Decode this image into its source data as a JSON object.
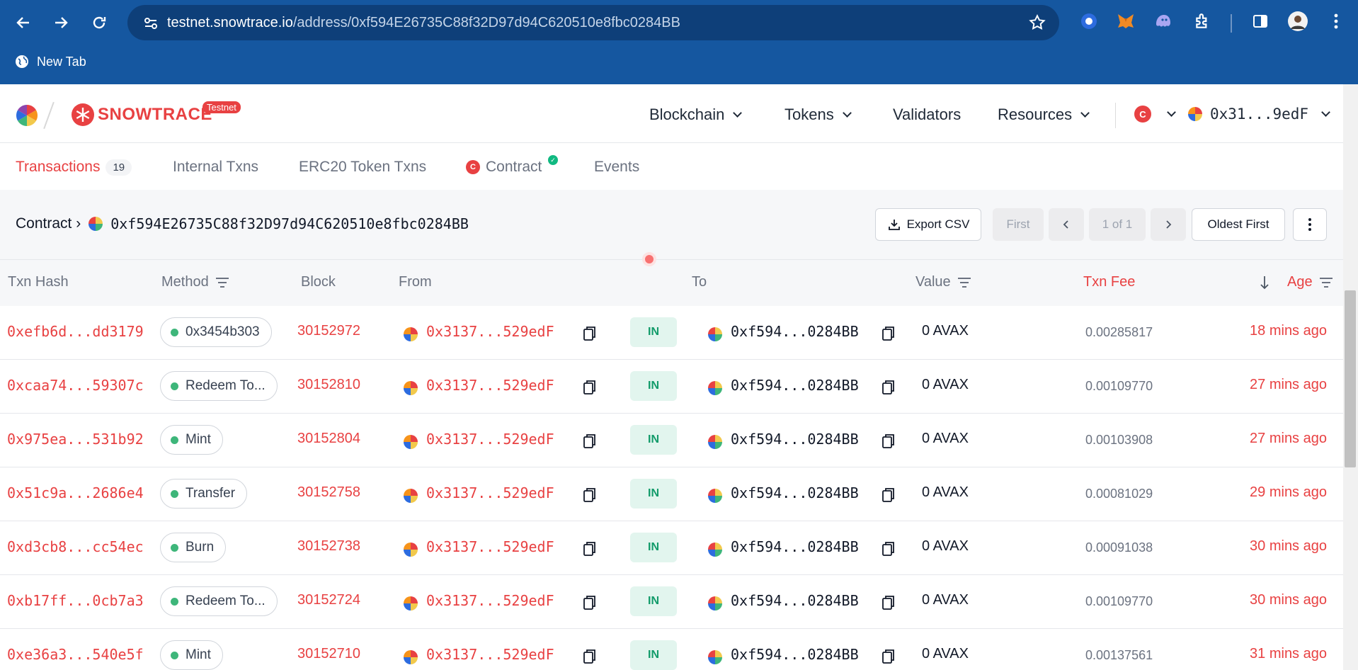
{
  "browser": {
    "url_host": "testnet.snowtrace.io",
    "url_path": "/address/0xf594E26735C88f32D97d94C620510e8fbc0284BB",
    "bookmark_label": "New Tab"
  },
  "header": {
    "logo_text": "SNOWTRACE",
    "badge": "Testnet",
    "nav": [
      "Blockchain",
      "Tokens",
      "Validators",
      "Resources"
    ],
    "chain_letter": "C",
    "wallet": "0x31...9edF"
  },
  "tabs": {
    "transactions": "Transactions",
    "transactions_count": "19",
    "internal": "Internal Txns",
    "erc20": "ERC20 Token Txns",
    "contract": "Contract",
    "contract_icon_letter": "C",
    "events": "Events"
  },
  "subheader": {
    "contract_label": "Contract ›",
    "contract_address": "0xf594E26735C88f32D97d94C620510e8fbc0284BB",
    "export_label": "Export CSV",
    "first_label": "First",
    "page_label": "1 of 1",
    "sort_label": "Oldest First"
  },
  "columns": {
    "hash": "Txn Hash",
    "method": "Method",
    "block": "Block",
    "from": "From",
    "to": "To",
    "value": "Value",
    "fee": "Txn Fee",
    "age": "Age"
  },
  "rows": [
    {
      "hash": "0xefb6d...dd3179",
      "method": "0x3454b303",
      "block": "30152972",
      "from": "0x3137...529edF",
      "direction": "IN",
      "to": "0xf594...0284BB",
      "value": "0 AVAX",
      "fee": "0.00285817",
      "age": "18 mins ago"
    },
    {
      "hash": "0xcaa74...59307c",
      "method": "Redeem To...",
      "block": "30152810",
      "from": "0x3137...529edF",
      "direction": "IN",
      "to": "0xf594...0284BB",
      "value": "0 AVAX",
      "fee": "0.00109770",
      "age": "27 mins ago"
    },
    {
      "hash": "0x975ea...531b92",
      "method": "Mint",
      "block": "30152804",
      "from": "0x3137...529edF",
      "direction": "IN",
      "to": "0xf594...0284BB",
      "value": "0 AVAX",
      "fee": "0.00103908",
      "age": "27 mins ago"
    },
    {
      "hash": "0x51c9a...2686e4",
      "method": "Transfer",
      "block": "30152758",
      "from": "0x3137...529edF",
      "direction": "IN",
      "to": "0xf594...0284BB",
      "value": "0 AVAX",
      "fee": "0.00081029",
      "age": "29 mins ago"
    },
    {
      "hash": "0xd3cb8...cc54ec",
      "method": "Burn",
      "block": "30152738",
      "from": "0x3137...529edF",
      "direction": "IN",
      "to": "0xf594...0284BB",
      "value": "0 AVAX",
      "fee": "0.00091038",
      "age": "30 mins ago"
    },
    {
      "hash": "0xb17ff...0cb7a3",
      "method": "Redeem To...",
      "block": "30152724",
      "from": "0x3137...529edF",
      "direction": "IN",
      "to": "0xf594...0284BB",
      "value": "0 AVAX",
      "fee": "0.00109770",
      "age": "30 mins ago"
    },
    {
      "hash": "0xe36a3...540e5f",
      "method": "Mint",
      "block": "30152710",
      "from": "0x3137...529edF",
      "direction": "IN",
      "to": "0xf594...0284BB",
      "value": "0 AVAX",
      "fee": "0.00137561",
      "age": "31 mins ago"
    }
  ],
  "colors": {
    "chrome_blue": "#1557a0",
    "accent_red": "#e84142",
    "in_green": "#129b6a"
  }
}
